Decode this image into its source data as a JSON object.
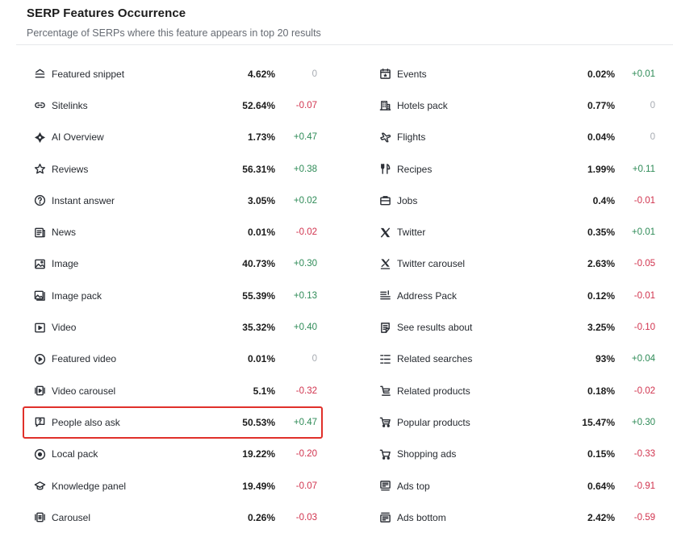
{
  "header": {
    "title": "SERP Features Occurrence",
    "subtitle": "Percentage of SERPs where this feature appears in top 20 results"
  },
  "colors": {
    "positive": "#2e8b57",
    "negative": "#d1334e",
    "neutral": "#a7abb2",
    "highlight": "#e0302a"
  },
  "left": [
    {
      "label": "Featured snippet",
      "pct": "4.62%",
      "delta": "0",
      "trend": "zero",
      "icon": "featured-snippet-icon"
    },
    {
      "label": "Sitelinks",
      "pct": "52.64%",
      "delta": "-0.07",
      "trend": "neg",
      "icon": "link-icon"
    },
    {
      "label": "AI Overview",
      "pct": "1.73%",
      "delta": "+0.47",
      "trend": "pos",
      "icon": "ai-sparkle-icon"
    },
    {
      "label": "Reviews",
      "pct": "56.31%",
      "delta": "+0.38",
      "trend": "pos",
      "icon": "star-icon"
    },
    {
      "label": "Instant answer",
      "pct": "3.05%",
      "delta": "+0.02",
      "trend": "pos",
      "icon": "question-circle-icon"
    },
    {
      "label": "News",
      "pct": "0.01%",
      "delta": "-0.02",
      "trend": "neg",
      "icon": "news-icon"
    },
    {
      "label": "Image",
      "pct": "40.73%",
      "delta": "+0.30",
      "trend": "pos",
      "icon": "image-icon"
    },
    {
      "label": "Image pack",
      "pct": "55.39%",
      "delta": "+0.13",
      "trend": "pos",
      "icon": "image-pack-icon"
    },
    {
      "label": "Video",
      "pct": "35.32%",
      "delta": "+0.40",
      "trend": "pos",
      "icon": "video-icon"
    },
    {
      "label": "Featured video",
      "pct": "0.01%",
      "delta": "0",
      "trend": "zero",
      "icon": "play-circle-icon"
    },
    {
      "label": "Video carousel",
      "pct": "5.1%",
      "delta": "-0.32",
      "trend": "neg",
      "icon": "video-carousel-icon"
    },
    {
      "label": "People also ask",
      "pct": "50.53%",
      "delta": "+0.47",
      "trend": "pos",
      "icon": "question-bubble-icon"
    },
    {
      "label": "Local pack",
      "pct": "19.22%",
      "delta": "-0.20",
      "trend": "neg",
      "icon": "location-pin-icon"
    },
    {
      "label": "Knowledge panel",
      "pct": "19.49%",
      "delta": "-0.07",
      "trend": "neg",
      "icon": "graduation-cap-icon"
    },
    {
      "label": "Carousel",
      "pct": "0.26%",
      "delta": "-0.03",
      "trend": "neg",
      "icon": "carousel-icon"
    }
  ],
  "right": [
    {
      "label": "Events",
      "pct": "0.02%",
      "delta": "+0.01",
      "trend": "pos",
      "icon": "calendar-icon"
    },
    {
      "label": "Hotels pack",
      "pct": "0.77%",
      "delta": "0",
      "trend": "zero",
      "icon": "hotel-icon"
    },
    {
      "label": "Flights",
      "pct": "0.04%",
      "delta": "0",
      "trend": "zero",
      "icon": "plane-icon"
    },
    {
      "label": "Recipes",
      "pct": "1.99%",
      "delta": "+0.11",
      "trend": "pos",
      "icon": "fork-knife-icon"
    },
    {
      "label": "Jobs",
      "pct": "0.4%",
      "delta": "-0.01",
      "trend": "neg",
      "icon": "briefcase-icon"
    },
    {
      "label": "Twitter",
      "pct": "0.35%",
      "delta": "+0.01",
      "trend": "pos",
      "icon": "x-logo-icon"
    },
    {
      "label": "Twitter carousel",
      "pct": "2.63%",
      "delta": "-0.05",
      "trend": "neg",
      "icon": "x-carousel-icon"
    },
    {
      "label": "Address Pack",
      "pct": "0.12%",
      "delta": "-0.01",
      "trend": "neg",
      "icon": "address-icon"
    },
    {
      "label": "See results about",
      "pct": "3.25%",
      "delta": "-0.10",
      "trend": "neg",
      "icon": "document-list-icon"
    },
    {
      "label": "Related searches",
      "pct": "93%",
      "delta": "+0.04",
      "trend": "pos",
      "icon": "list-icon"
    },
    {
      "label": "Related products",
      "pct": "0.18%",
      "delta": "-0.02",
      "trend": "neg",
      "icon": "product-icon"
    },
    {
      "label": "Popular products",
      "pct": "15.47%",
      "delta": "+0.30",
      "trend": "pos",
      "icon": "cart-icon"
    },
    {
      "label": "Shopping ads",
      "pct": "0.15%",
      "delta": "-0.33",
      "trend": "neg",
      "icon": "shopping-cart-icon"
    },
    {
      "label": "Ads top",
      "pct": "0.64%",
      "delta": "-0.91",
      "trend": "neg",
      "icon": "ads-top-icon"
    },
    {
      "label": "Ads bottom",
      "pct": "2.42%",
      "delta": "-0.59",
      "trend": "neg",
      "icon": "ads-bottom-icon"
    }
  ]
}
